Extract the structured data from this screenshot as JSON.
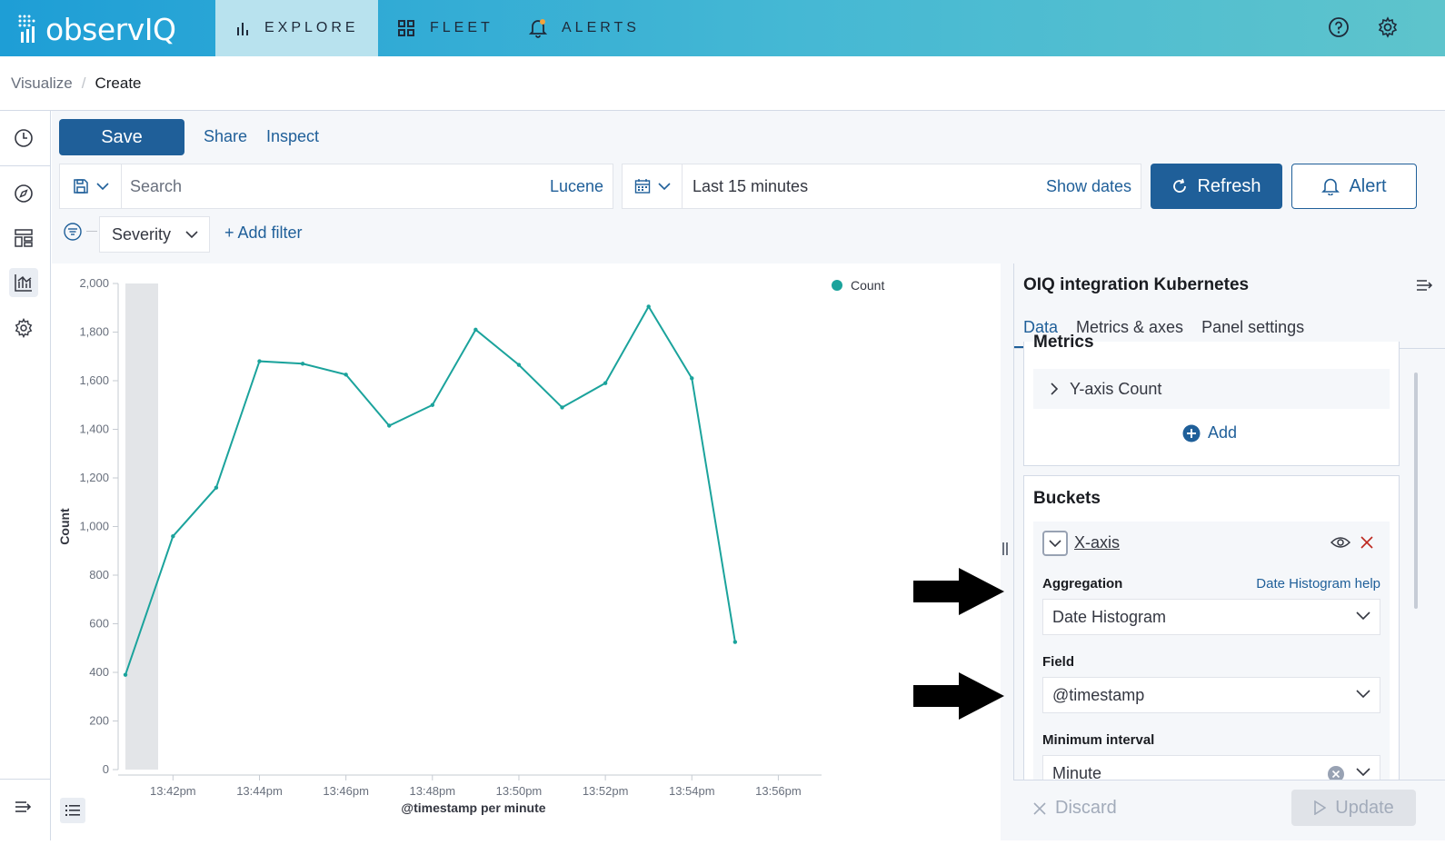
{
  "header": {
    "brand": "observIQ",
    "nav": [
      {
        "label": "EXPLORE",
        "icon": "bar-chart-icon",
        "active": true
      },
      {
        "label": "FLEET",
        "icon": "grid-icon",
        "active": false
      },
      {
        "label": "ALERTS",
        "icon": "bell-icon",
        "active": false
      }
    ],
    "accent": "#1e9ed6"
  },
  "breadcrumb": {
    "items": [
      "Visualize",
      "Create"
    ],
    "separator": "/"
  },
  "toolbar": {
    "save_label": "Save",
    "share_label": "Share",
    "inspect_label": "Inspect"
  },
  "query": {
    "placeholder": "Search",
    "language": "Lucene"
  },
  "date_picker": {
    "range": "Last 15 minutes",
    "show_dates": "Show dates",
    "refresh_label": "Refresh",
    "alert_label": "Alert"
  },
  "filters": {
    "severity_label": "Severity",
    "add_filter_label": "+ Add filter"
  },
  "chart_data": {
    "type": "line",
    "series": [
      {
        "name": "Count",
        "color": "#1ba39c",
        "x": [
          "13:41",
          "13:42",
          "13:43",
          "13:44",
          "13:45",
          "13:46",
          "13:47",
          "13:48",
          "13:49",
          "13:50",
          "13:51",
          "13:52",
          "13:53",
          "13:54",
          "13:55"
        ],
        "values": [
          390,
          960,
          1160,
          1680,
          1670,
          1625,
          1415,
          1500,
          1810,
          1665,
          1490,
          1590,
          1905,
          1610,
          525
        ]
      }
    ],
    "xticks": [
      "13:42pm",
      "13:44pm",
      "13:46pm",
      "13:48pm",
      "13:50pm",
      "13:52pm",
      "13:54pm",
      "13:56pm"
    ],
    "yticks": [
      "0",
      "200",
      "400",
      "600",
      "800",
      "1,000",
      "1,200",
      "1,400",
      "1,600",
      "1,800",
      "2,000"
    ],
    "ylim": [
      0,
      2000
    ],
    "xlabel": "@timestamp per minute",
    "ylabel": "Count",
    "legend": "top-right",
    "grid": false
  },
  "editor": {
    "title": "OIQ integration Kubernetes",
    "tabs": [
      "Data",
      "Metrics & axes",
      "Panel settings"
    ],
    "active_tab": "Data",
    "metrics": {
      "heading": "Metrics",
      "item": "Y-axis Count",
      "add_label": "Add"
    },
    "buckets": {
      "heading": "Buckets",
      "item": "X-axis",
      "aggregation_label": "Aggregation",
      "aggregation_help": "Date Histogram help",
      "aggregation_value": "Date Histogram",
      "field_label": "Field",
      "field_value": "@timestamp",
      "interval_label": "Minimum interval",
      "interval_value": "Minute"
    },
    "discard_label": "Discard",
    "update_label": "Update"
  }
}
